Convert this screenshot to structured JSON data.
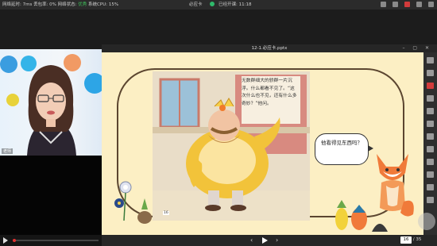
{
  "status_bar": {
    "stats_prefix": "网络延时: 7ms 丢包率: 0% 网络状态:",
    "net_quality": "优秀",
    "cpu": "系统CPU: 15%",
    "app_name": "必应卡",
    "live_label": "已经开课: 11:18"
  },
  "video": {
    "teacher_label": "老师"
  },
  "ppt": {
    "file_title": "12-1.必应卡.pptx",
    "win_controls": "– ▢ ✕",
    "story_text": "无数群细大的骄群一片沉浮。什么都看不见了。“这次什么也不见，还有什么多奇妙？”他问。",
    "speech_text": "他看得见东西吗？",
    "small_page_num": "16",
    "current_page": "16",
    "total_pages": "/ 35",
    "prev_symbol": "‹",
    "next_symbol": "›"
  },
  "colors": {
    "slide_bg": "#fcefc4",
    "frame_brown": "#5c4630",
    "accent_red": "#d23b3b",
    "good_green": "#3fbf5a"
  }
}
